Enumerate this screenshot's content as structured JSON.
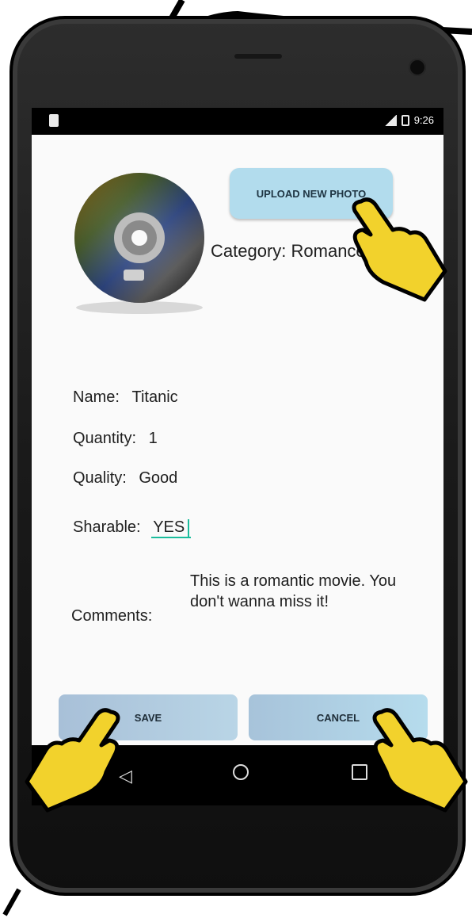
{
  "status_bar": {
    "time": "9:26",
    "signal_icon": "signal-icon",
    "battery_icon": "battery-icon",
    "sim_icon": "sim-icon"
  },
  "header": {
    "upload_button_label": "UPLOAD NEW PHOTO",
    "category_label": "Category:",
    "category_value": "Romance"
  },
  "fields": {
    "name_label": "Name:",
    "name_value": "Titanic",
    "quantity_label": "Quantity:",
    "quantity_value": "1",
    "quality_label": "Quality:",
    "quality_value": "Good",
    "sharable_label": "Sharable:",
    "sharable_value": "YES",
    "comments_label": "Comments:",
    "comments_value": "This is a romantic movie. You don't wanna miss it!"
  },
  "actions": {
    "save_label": "SAVE",
    "cancel_label": "CANCEL"
  },
  "navigation": {
    "back_icon": "back-icon",
    "home_icon": "home-icon",
    "recent_apps_icon": "recent-apps-icon"
  },
  "colors": {
    "upload_button": "#b2dced",
    "accent": "#1abc9c",
    "pointer_hand": "#f2d22c"
  }
}
